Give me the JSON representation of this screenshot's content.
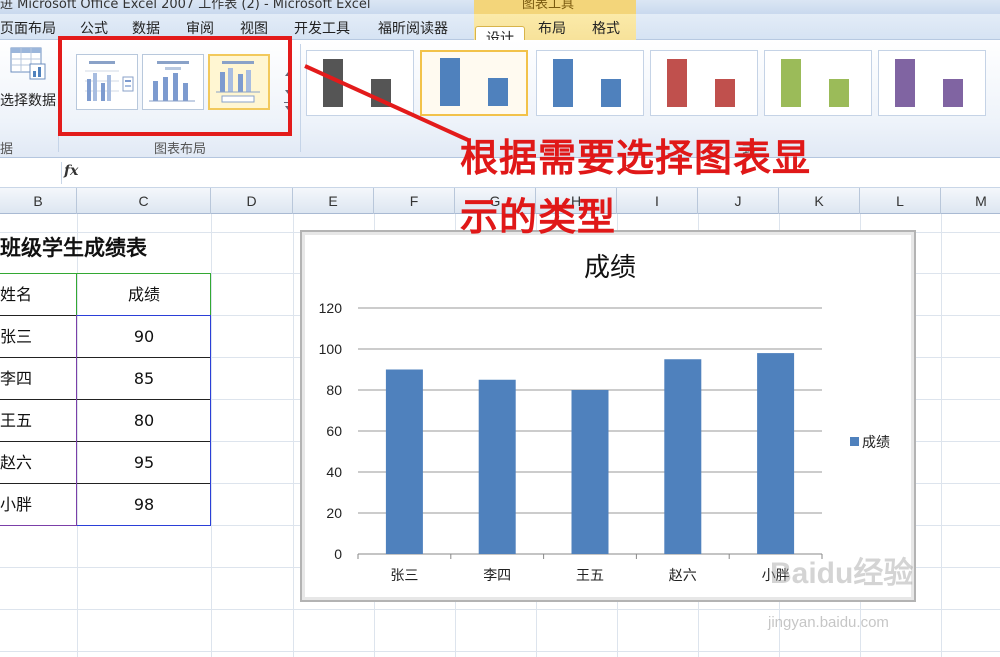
{
  "titlebar": {
    "text": "进 Microsoft Office Excel 2007 工作表 (2) - Microsoft Excel",
    "context_group_label": "图表工具"
  },
  "menu": {
    "items": [
      "页面布局",
      "公式",
      "数据",
      "审阅",
      "视图",
      "开发工具",
      "福昕阅读器"
    ],
    "context_tabs": [
      "设计",
      "布局",
      "格式"
    ],
    "active_tab": "设计"
  },
  "ribbon": {
    "select_data_label": "选择数据",
    "group_left_label": "据",
    "chart_layouts_label": "图表布局",
    "chart_styles_label": "图表样式",
    "chart_styles_visible": "图表",
    "chart_styles_tail": "式",
    "style_colors": [
      "#555555",
      "#4f81bd",
      "#4f81bd",
      "#c0504d",
      "#9bbb59",
      "#8064a2"
    ]
  },
  "formula_bar": {
    "fx": "fx"
  },
  "columns": [
    "B",
    "C",
    "D",
    "E",
    "F",
    "G",
    "H",
    "I",
    "J",
    "K",
    "L",
    "M"
  ],
  "sheet": {
    "title": "班级学生成绩表",
    "headers": [
      "姓名",
      "成绩"
    ],
    "rows": [
      [
        "张三",
        "90"
      ],
      [
        "李四",
        "85"
      ],
      [
        "王五",
        "80"
      ],
      [
        "赵六",
        "95"
      ],
      [
        "小胖",
        "98"
      ]
    ]
  },
  "annotation": {
    "line1": "根据需要选择图表显",
    "line2": "示的类型",
    "color": "#e01818"
  },
  "chart_data": {
    "type": "bar",
    "title": "成绩",
    "categories": [
      "张三",
      "李四",
      "王五",
      "赵六",
      "小胖"
    ],
    "series": [
      {
        "name": "成绩",
        "values": [
          90,
          85,
          80,
          95,
          98
        ],
        "color": "#4f81bd"
      }
    ],
    "ylim": [
      0,
      120
    ],
    "yticks": [
      0,
      20,
      40,
      60,
      80,
      100,
      120
    ],
    "grid": true,
    "legend": "right"
  },
  "watermark": {
    "main": "Baidu经验",
    "sub": "jingyan.baidu.com"
  }
}
